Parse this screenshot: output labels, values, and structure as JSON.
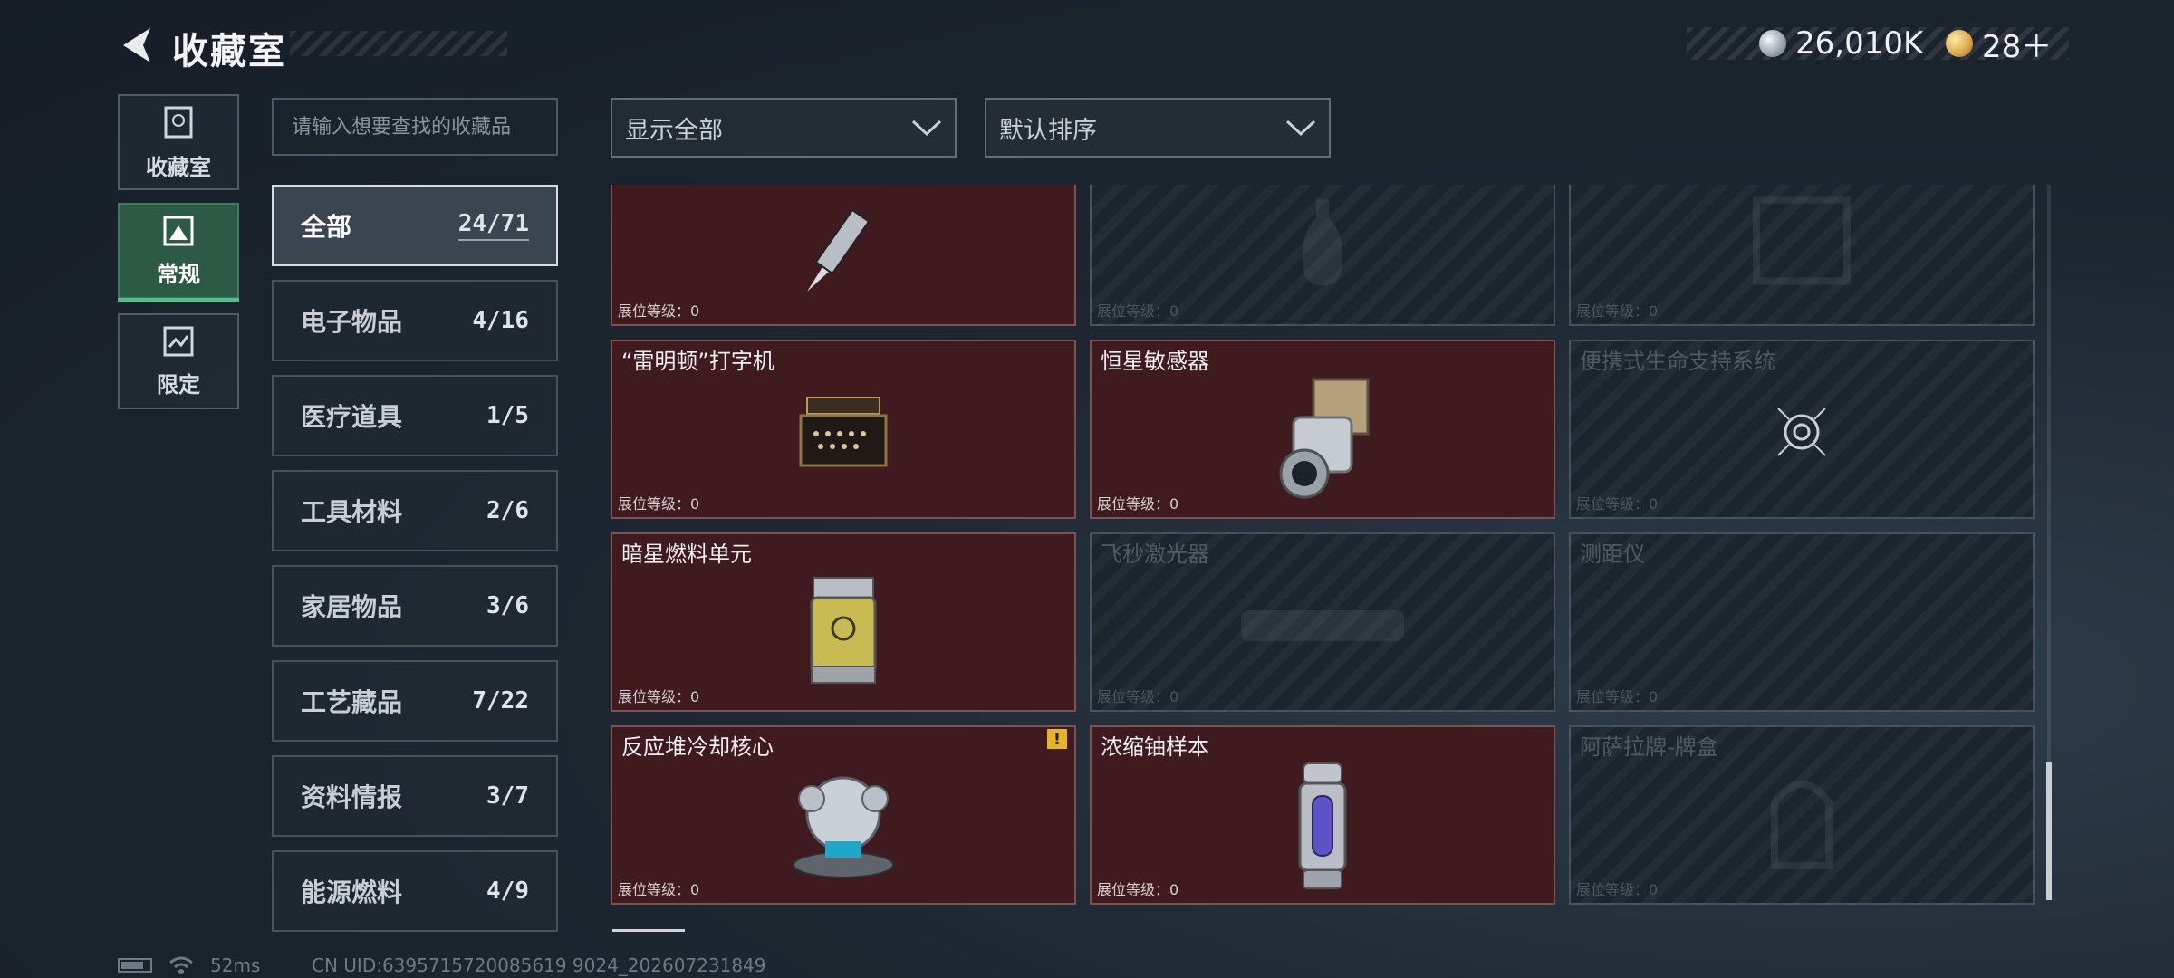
{
  "header": {
    "title": "收藏室",
    "currency": [
      {
        "icon": "silver-coin-icon",
        "value": "26,010K"
      },
      {
        "icon": "gold-coin-icon",
        "value": "28＋"
      }
    ]
  },
  "nav": [
    {
      "label": "收藏室",
      "icon": "collection-room-icon",
      "active": false
    },
    {
      "label": "常规",
      "icon": "regular-icon",
      "active": true
    },
    {
      "label": "限定",
      "icon": "limited-icon",
      "active": false
    }
  ],
  "search": {
    "placeholder": "请输入想要查找的收藏品"
  },
  "categories": [
    {
      "name": "全部",
      "count": "24/71",
      "active": true
    },
    {
      "name": "电子物品",
      "count": "4/16"
    },
    {
      "name": "医疗道具",
      "count": "1/5"
    },
    {
      "name": "工具材料",
      "count": "2/6"
    },
    {
      "name": "家居物品",
      "count": "3/6"
    },
    {
      "name": "工艺藏品",
      "count": "7/22"
    },
    {
      "name": "资料情报",
      "count": "3/7"
    },
    {
      "name": "能源燃料",
      "count": "4/9"
    }
  ],
  "filters": {
    "display": "显示全部",
    "sort": "默认排序"
  },
  "level_label": "展位等级：",
  "items": [
    {
      "name": "",
      "level": "0",
      "owned": true,
      "icon": "pen-knife-icon"
    },
    {
      "name": "",
      "level": "0",
      "owned": false,
      "icon": "vase-icon"
    },
    {
      "name": "",
      "level": "0",
      "owned": false,
      "icon": "frame-icon"
    },
    {
      "name": "“雷明顿”打字机",
      "level": "0",
      "owned": true,
      "icon": "typewriter-icon"
    },
    {
      "name": "恒星敏感器",
      "level": "0",
      "owned": true,
      "icon": "star-sensor-icon"
    },
    {
      "name": "便携式生命支持系统",
      "level": "0",
      "owned": false,
      "icon": "life-support-icon"
    },
    {
      "name": "暗星燃料单元",
      "level": "0",
      "owned": true,
      "icon": "fuel-canister-icon"
    },
    {
      "name": "飞秒激光器",
      "level": "0",
      "owned": false,
      "icon": "laser-icon"
    },
    {
      "name": "测距仪",
      "level": "0",
      "owned": false,
      "icon": "rangefinder-icon"
    },
    {
      "name": "反应堆冷却核心",
      "level": "0",
      "owned": true,
      "icon": "reactor-core-icon",
      "badge": "!"
    },
    {
      "name": "浓缩铀样本",
      "level": "0",
      "owned": true,
      "icon": "uranium-sample-icon"
    },
    {
      "name": "阿萨拉牌-牌盒",
      "level": "0",
      "owned": false,
      "icon": "card-box-icon"
    }
  ],
  "status": {
    "ping": "52ms",
    "uid": "CN UID:6395715720085619 9024_202607231849"
  }
}
